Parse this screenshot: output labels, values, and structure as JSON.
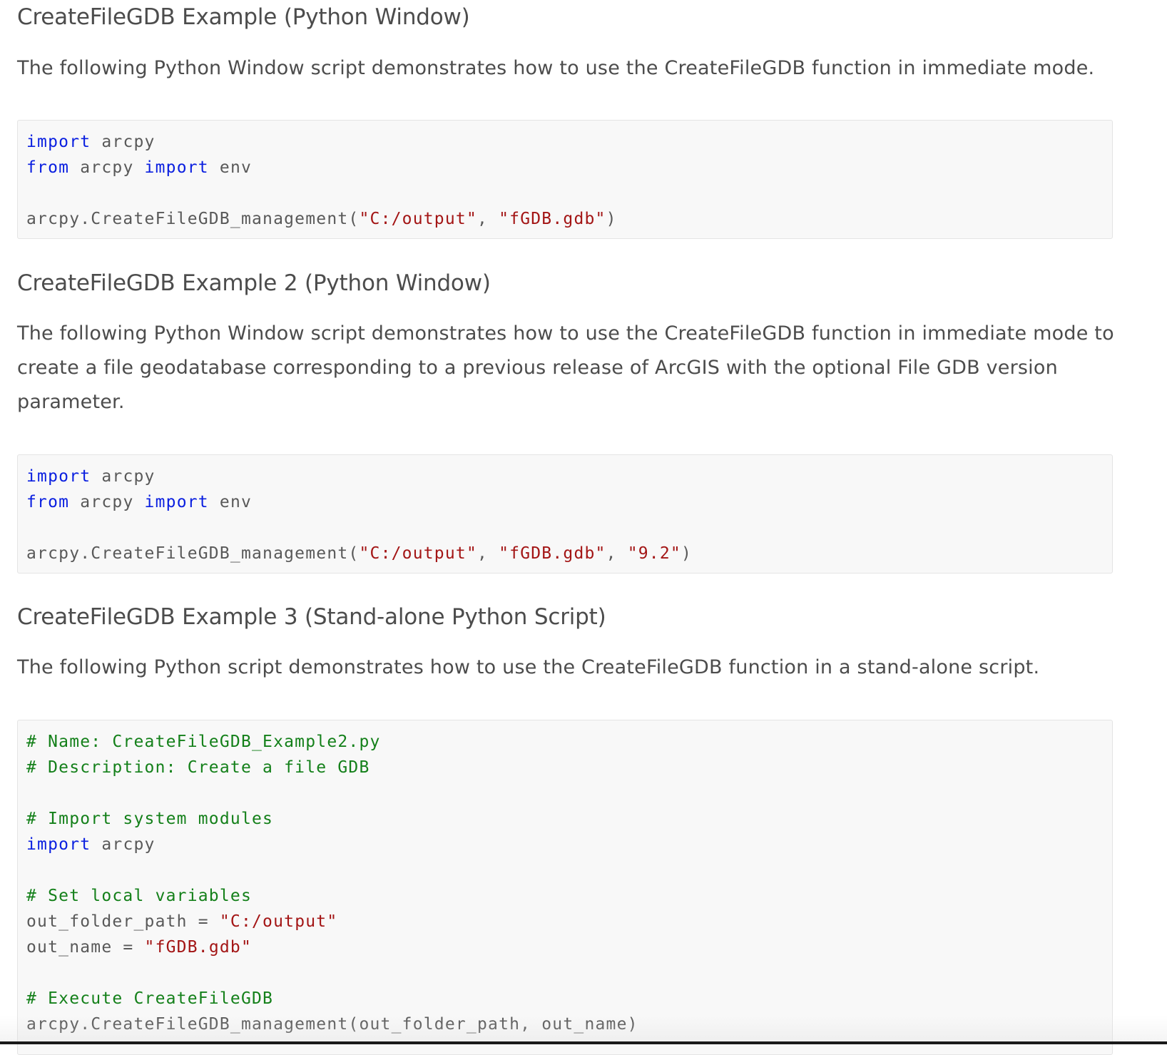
{
  "sections": [
    {
      "title": "CreateFileGDB Example (Python Window)",
      "description": "The following Python Window script demonstrates how to use the CreateFileGDB function in immediate mode.",
      "code": [
        [
          {
            "t": "kw",
            "v": "import"
          },
          {
            "t": "plain",
            "v": " arcpy"
          }
        ],
        [
          {
            "t": "kw",
            "v": "from"
          },
          {
            "t": "plain",
            "v": " arcpy "
          },
          {
            "t": "kw",
            "v": "import"
          },
          {
            "t": "plain",
            "v": " env"
          }
        ],
        [],
        [
          {
            "t": "plain",
            "v": "arcpy.CreateFileGDB_management("
          },
          {
            "t": "str",
            "v": "\"C:/output\""
          },
          {
            "t": "plain",
            "v": ", "
          },
          {
            "t": "str",
            "v": "\"fGDB.gdb\""
          },
          {
            "t": "plain",
            "v": ")"
          }
        ]
      ]
    },
    {
      "title": "CreateFileGDB Example 2 (Python Window)",
      "description": "The following Python Window script demonstrates how to use the CreateFileGDB function in immediate mode to create a file geodatabase corresponding to a previous release of ArcGIS with the optional File GDB version parameter.",
      "code": [
        [
          {
            "t": "kw",
            "v": "import"
          },
          {
            "t": "plain",
            "v": " arcpy"
          }
        ],
        [
          {
            "t": "kw",
            "v": "from"
          },
          {
            "t": "plain",
            "v": " arcpy "
          },
          {
            "t": "kw",
            "v": "import"
          },
          {
            "t": "plain",
            "v": " env"
          }
        ],
        [],
        [
          {
            "t": "plain",
            "v": "arcpy.CreateFileGDB_management("
          },
          {
            "t": "str",
            "v": "\"C:/output\""
          },
          {
            "t": "plain",
            "v": ", "
          },
          {
            "t": "str",
            "v": "\"fGDB.gdb\""
          },
          {
            "t": "plain",
            "v": ", "
          },
          {
            "t": "str",
            "v": "\"9.2\""
          },
          {
            "t": "plain",
            "v": ")"
          }
        ]
      ]
    },
    {
      "title": "CreateFileGDB Example 3 (Stand-alone Python Script)",
      "description": "The following Python script demonstrates how to use the CreateFileGDB function in a stand-alone script.",
      "code": [
        [
          {
            "t": "cm",
            "v": "# Name: CreateFileGDB_Example2.py"
          }
        ],
        [
          {
            "t": "cm",
            "v": "# Description: Create a file GDB"
          }
        ],
        [],
        [
          {
            "t": "cm",
            "v": "# Import system modules"
          }
        ],
        [
          {
            "t": "kw",
            "v": "import"
          },
          {
            "t": "plain",
            "v": " arcpy"
          }
        ],
        [],
        [
          {
            "t": "cm",
            "v": "# Set local variables"
          }
        ],
        [
          {
            "t": "plain",
            "v": "out_folder_path = "
          },
          {
            "t": "str",
            "v": "\"C:/output\""
          }
        ],
        [
          {
            "t": "plain",
            "v": "out_name = "
          },
          {
            "t": "str",
            "v": "\"fGDB.gdb\""
          }
        ],
        [],
        [
          {
            "t": "cm",
            "v": "# Execute CreateFileGDB"
          }
        ],
        [
          {
            "t": "plain",
            "v": "arcpy.CreateFileGDB_management(out_folder_path, out_name)"
          }
        ]
      ]
    }
  ]
}
